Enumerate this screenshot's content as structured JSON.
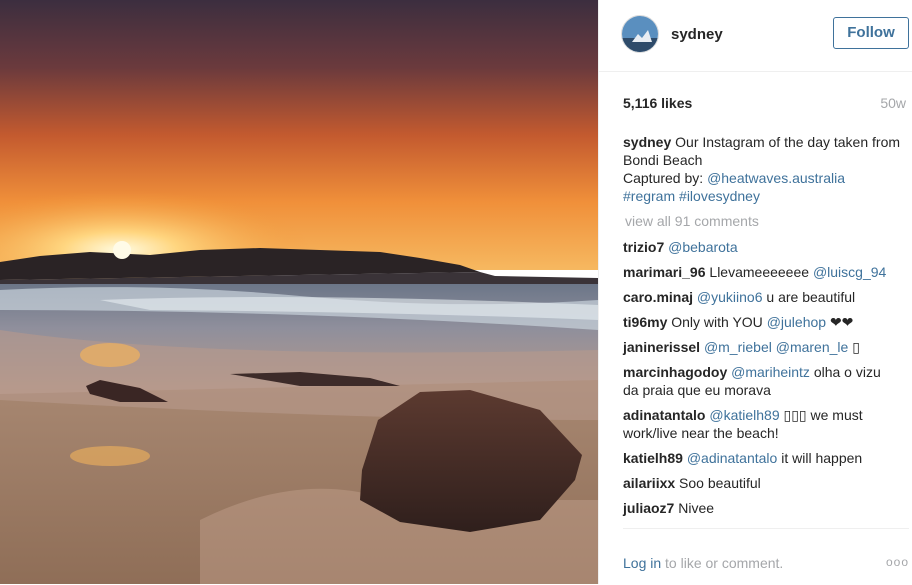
{
  "post": {
    "username": "sydney",
    "follow_label": "Follow",
    "likes": "5,116 likes",
    "age": "50w",
    "caption": {
      "user": "sydney",
      "text1": " Our Instagram of the day taken from Bondi Beach",
      "text2": "Captured by: ",
      "mention": "@heatwaves.australia",
      "tag1": "#regram",
      "tag2": "#ilovesydney"
    },
    "view_all": "view all 91 comments",
    "comments": [
      {
        "user": "trizio7",
        "mention": "@bebarota",
        "text": ""
      },
      {
        "user": "marimari_96",
        "text_pre": " Llevameeeeeee ",
        "mention": "@luiscg_94"
      },
      {
        "user": "caro.minaj",
        "mention": "@yukiino6",
        "text": " u are beautiful"
      },
      {
        "user": "ti96my",
        "text_pre": " Only with YOU ",
        "mention": "@julehop",
        "text": " ❤❤"
      },
      {
        "user": "janinerissel",
        "mention": "@m_riebel",
        "mention2": "@maren_le",
        "text": " ▯"
      },
      {
        "user": "marcinhagodoy",
        "mention": "@mariheintz",
        "text": " olha o vizu da praia que eu morava"
      },
      {
        "user": "adinatantalo",
        "mention": "@katielh89",
        "text": " ▯▯▯ we must work/live near the beach!"
      },
      {
        "user": "katielh89",
        "mention": "@adinatantalo",
        "text": " it will happen"
      },
      {
        "user": "ailariixx",
        "text": " Soo beautiful"
      },
      {
        "user": "juliaoz7",
        "text": " Nivee"
      }
    ],
    "login_link": "Log in",
    "login_text": " to like or comment.",
    "more_label": "ooo"
  },
  "colors": {
    "link": "#3f729b",
    "muted": "#a5a7aa",
    "text": "#262626"
  },
  "icons": {
    "more": "ellipsis-icon"
  }
}
